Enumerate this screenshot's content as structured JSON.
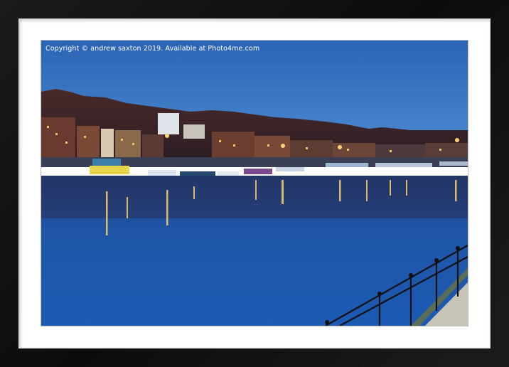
{
  "copyright": "Copyright © andrew saxton 2019. Available at Photo4me.com",
  "colors": {
    "sky": "#2f6fbf",
    "water": "#1e5bb0",
    "frame": "#111111",
    "mount": "#ffffff"
  }
}
